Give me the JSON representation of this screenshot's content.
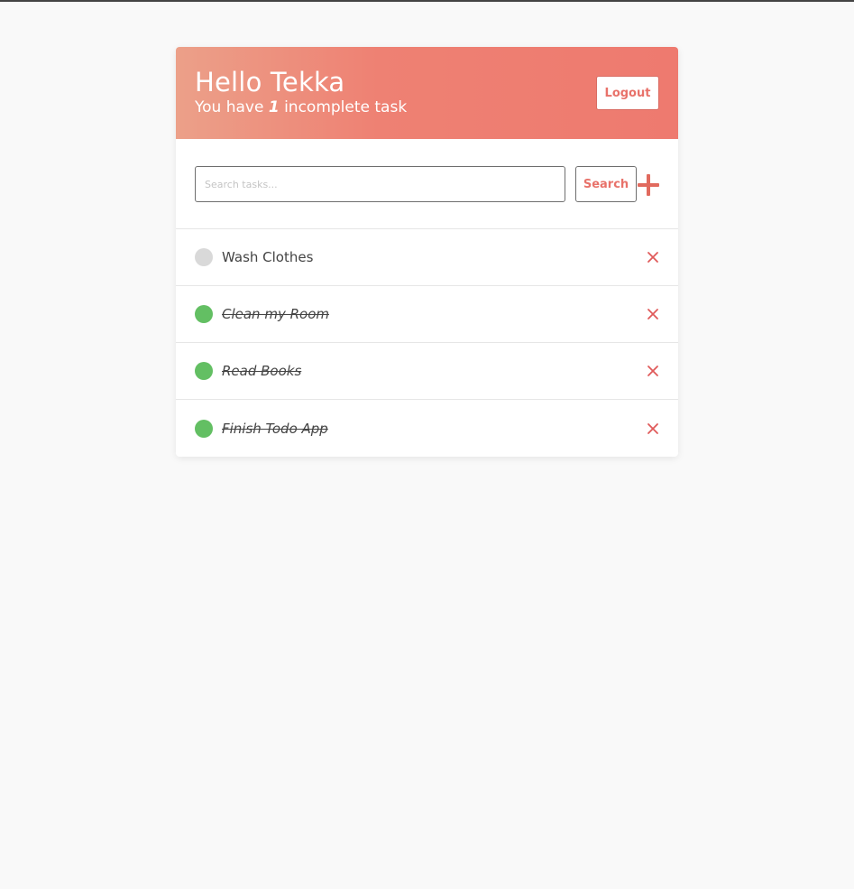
{
  "header": {
    "greeting": "Hello Tekka",
    "subtitle_prefix": "You have ",
    "incomplete_count": "1",
    "subtitle_suffix": " incomplete task",
    "logout_label": "Logout"
  },
  "search": {
    "placeholder": "Search tasks...",
    "value": "",
    "button_label": "Search",
    "add_icon": "plus-icon"
  },
  "tasks": [
    {
      "text": "Wash Clothes",
      "completed": false
    },
    {
      "text": "Clean my Room",
      "completed": true
    },
    {
      "text": "Read Books",
      "completed": true
    },
    {
      "text": "Finish Todo App",
      "completed": true
    }
  ],
  "colors": {
    "header_gradient_start": "#eca089",
    "header_gradient_end": "#ee7a6f",
    "accent": "#e8726a",
    "done": "#63bf63",
    "pending": "#d9d9d9",
    "delete": "#e05a5a"
  }
}
